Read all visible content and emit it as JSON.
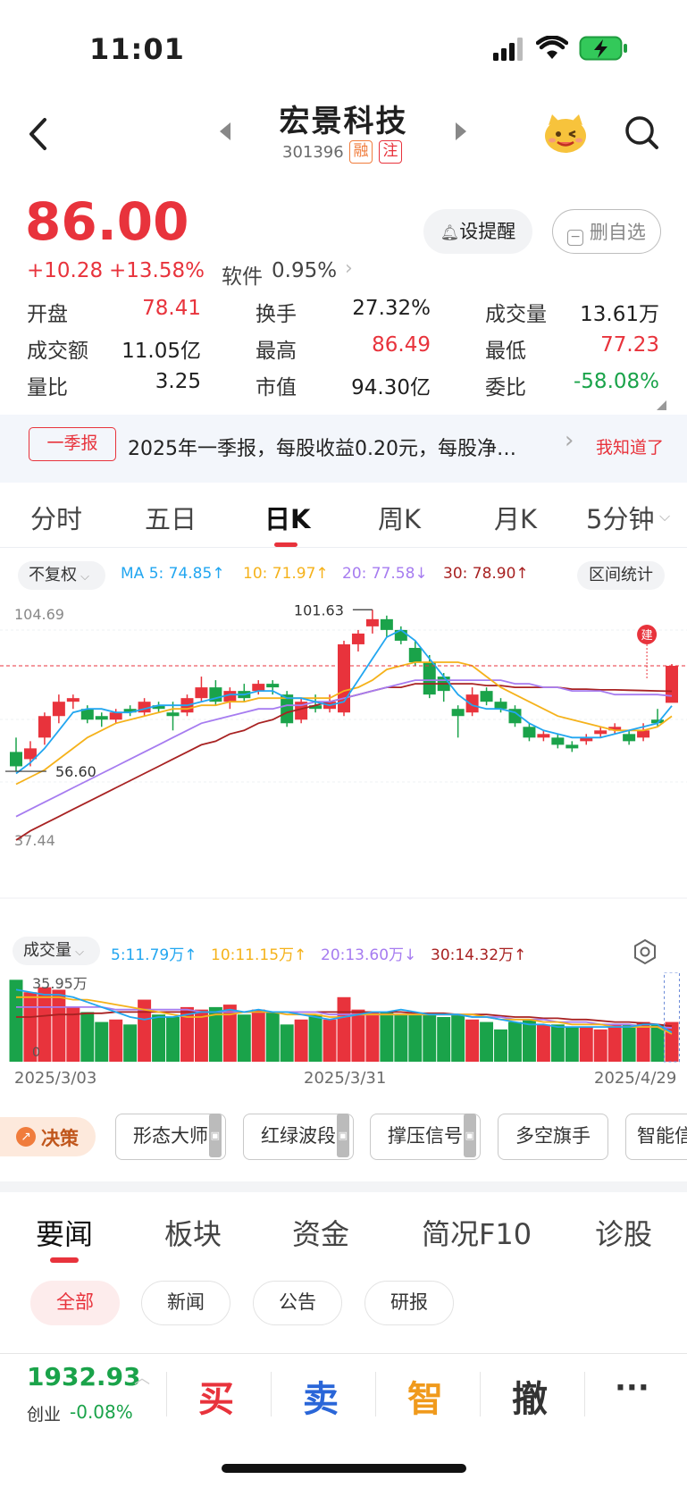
{
  "status": {
    "time": "11:01"
  },
  "header": {
    "title": "宏景科技",
    "code": "301396",
    "tag1": "融",
    "tag2": "注"
  },
  "quote": {
    "price": "86.00",
    "change": "+10.28",
    "change_pct": "+13.58%",
    "sector": "软件",
    "sector_pct": "0.95%",
    "alert_btn": "设提醒",
    "remove_btn": "删自选"
  },
  "stats": [
    {
      "label": "开盘",
      "value": "78.41",
      "color": "red"
    },
    {
      "label": "换手",
      "value": "27.32%",
      "color": "black"
    },
    {
      "label": "成交量",
      "value": "13.61万",
      "color": "black"
    },
    {
      "label": "成交额",
      "value": "11.05亿",
      "color": "black"
    },
    {
      "label": "最高",
      "value": "86.49",
      "color": "red"
    },
    {
      "label": "最低",
      "value": "77.23",
      "color": "red"
    },
    {
      "label": "量比",
      "value": "3.25",
      "color": "black"
    },
    {
      "label": "市值",
      "value": "94.30亿",
      "color": "black"
    },
    {
      "label": "委比",
      "value": "-58.08%",
      "color": "green"
    }
  ],
  "notice": {
    "badge": "一季报",
    "text": "2025年一季报，每股收益0.20元，每股净…",
    "dismiss": "我知道了"
  },
  "ktabs": [
    "分时",
    "五日",
    "日K",
    "周K",
    "月K",
    "5分钟"
  ],
  "ma": {
    "adjust": "不复权",
    "ma5": "MA 5: 74.85↑",
    "ma10": "10: 71.97↑",
    "ma20": "20: 77.58↓",
    "ma30": "30: 78.90↑",
    "range_btn": "区间统计"
  },
  "vol_ma": {
    "label": "成交量",
    "v5": "5:11.79万↑",
    "v10": "10:11.15万↑",
    "v20": "20:13.60万↓",
    "v30": "30:14.32万↑"
  },
  "chart_data": {
    "type": "candlestick",
    "price_axis": {
      "top_label": "104.69",
      "bottom_label": "37.44",
      "min": 37.44,
      "max": 104.69
    },
    "annotations": {
      "high": "101.63",
      "low": "56.60",
      "marker": "建"
    },
    "dates": [
      "2025/3/03",
      "2025/3/31",
      "2025/4/29"
    ],
    "volume_axis": {
      "top_label": "35.95万",
      "bottom_label": "0"
    },
    "candles": [
      [
        62,
        58,
        66,
        56.6
      ],
      [
        60,
        63,
        65,
        58
      ],
      [
        66,
        72,
        73,
        64
      ],
      [
        72,
        76,
        78,
        70
      ],
      [
        76,
        77,
        78,
        74
      ],
      [
        74,
        71,
        75,
        70
      ],
      [
        72,
        71,
        73,
        69
      ],
      [
        71,
        73,
        74,
        70
      ],
      [
        74,
        73,
        75,
        72
      ],
      [
        73,
        76,
        77,
        72
      ],
      [
        75,
        74,
        76,
        73
      ],
      [
        73,
        72,
        76,
        68
      ],
      [
        73,
        77,
        78,
        72
      ],
      [
        77,
        80,
        83,
        76
      ],
      [
        80,
        76,
        82,
        75
      ],
      [
        76,
        79,
        80,
        74
      ],
      [
        79,
        77,
        81,
        76
      ],
      [
        79,
        81,
        82,
        78
      ],
      [
        81,
        80,
        82,
        78
      ],
      [
        78,
        70,
        79,
        69
      ],
      [
        71,
        76,
        77,
        70
      ],
      [
        75,
        74,
        78,
        73
      ],
      [
        74,
        76,
        78,
        73
      ],
      [
        73,
        92,
        93,
        72
      ],
      [
        92,
        95,
        96,
        90
      ],
      [
        97,
        99,
        101.63,
        95
      ],
      [
        99,
        96,
        100,
        94
      ],
      [
        96,
        93,
        97,
        92
      ],
      [
        91,
        87,
        93,
        86
      ],
      [
        87,
        78,
        89,
        77
      ],
      [
        83,
        79,
        84,
        76
      ],
      [
        74,
        72,
        75,
        66
      ],
      [
        73,
        78,
        80,
        72
      ],
      [
        79,
        76,
        80,
        75
      ],
      [
        76,
        74,
        77,
        73
      ],
      [
        74,
        70,
        75,
        69
      ],
      [
        69,
        66,
        70,
        65
      ],
      [
        66,
        67,
        68,
        65
      ],
      [
        66,
        64,
        67,
        63
      ],
      [
        64,
        63,
        65,
        62
      ],
      [
        65,
        66,
        67,
        64
      ],
      [
        67,
        68,
        69,
        66
      ],
      [
        68,
        69,
        70,
        67
      ],
      [
        67,
        65,
        68,
        64
      ],
      [
        66,
        68,
        70,
        65
      ],
      [
        71,
        70,
        74,
        69
      ],
      [
        75.7,
        86.0,
        86.49,
        77.23
      ]
    ],
    "ma5": [
      56,
      59,
      63,
      68,
      73,
      74,
      74,
      73,
      73,
      74,
      75,
      75,
      75,
      76,
      77,
      78,
      78,
      79,
      79,
      77,
      77,
      76,
      75,
      76,
      82,
      88,
      94,
      96,
      93,
      88,
      83,
      78,
      75,
      74,
      74,
      73,
      70,
      68,
      67,
      66,
      66,
      66,
      67,
      68,
      69,
      70,
      74.85
    ],
    "ma10": [
      53,
      55,
      57,
      60,
      63,
      66,
      68,
      70,
      71,
      72,
      73,
      74,
      74,
      75,
      75,
      76,
      76,
      77,
      77,
      77,
      77,
      77,
      77,
      79,
      80,
      82,
      85,
      86,
      87,
      87,
      87,
      87,
      86,
      83,
      80,
      78,
      76,
      74,
      72,
      71,
      70,
      69,
      68,
      68,
      68,
      69,
      71.97
    ],
    "ma20": [
      44,
      46,
      48,
      50,
      52,
      54,
      56,
      58,
      60,
      62,
      64,
      66,
      68,
      70,
      71,
      72,
      73,
      74,
      74,
      75,
      75,
      76,
      76,
      77,
      78,
      79,
      80,
      81,
      82,
      82,
      82,
      82,
      82,
      82,
      82,
      81,
      81,
      80,
      80,
      79,
      79,
      79,
      78,
      78,
      78,
      78,
      77.58
    ],
    "ma30": [
      37.44,
      40,
      42,
      44,
      46,
      48,
      50,
      52,
      54,
      56,
      58,
      60,
      62,
      64,
      65,
      67,
      68,
      70,
      71,
      73,
      74,
      75,
      76,
      77,
      78,
      79,
      80,
      80,
      81,
      81,
      81,
      81,
      81,
      80.5,
      80.5,
      80,
      80,
      80,
      80,
      79.5,
      79.5,
      79.3,
      79.3,
      79.2,
      79.1,
      79,
      78.9
    ],
    "volumes": [
      33,
      28,
      30,
      29,
      22,
      20,
      16,
      17,
      15,
      25,
      19,
      18,
      22,
      21,
      22,
      23,
      19,
      21,
      20,
      15,
      17,
      19,
      17,
      26,
      21,
      20,
      20,
      19,
      19,
      19,
      18,
      19,
      17,
      16,
      13,
      16,
      17,
      15,
      15,
      14,
      14,
      13,
      15,
      15,
      16,
      15,
      16
    ],
    "vol_ma": {
      "v5": [
        29,
        28,
        27,
        27,
        26,
        24,
        22,
        20,
        18,
        17,
        18,
        18,
        19,
        20,
        20,
        21,
        20,
        21,
        20,
        20,
        19,
        18,
        17,
        18,
        19,
        20,
        20,
        21,
        20,
        19,
        19,
        19,
        18,
        18,
        17,
        16,
        15,
        15,
        14,
        14,
        14,
        14,
        14,
        14,
        15,
        15,
        11.79
      ],
      "v10": [
        26,
        26,
        26,
        26,
        25,
        25,
        24,
        23,
        22,
        21,
        20,
        19,
        18,
        18,
        19,
        19,
        20,
        20,
        20,
        19,
        19,
        19,
        18,
        18,
        19,
        19,
        19,
        19,
        19,
        19,
        19,
        19,
        19,
        18,
        17,
        17,
        17,
        16,
        16,
        15,
        15,
        15,
        14,
        14,
        14,
        14,
        11.15
      ],
      "v20": [
        22,
        22,
        22,
        22,
        22,
        22,
        22,
        21,
        21,
        21,
        21,
        21,
        21,
        20,
        20,
        20,
        20,
        20,
        20,
        20,
        20,
        20,
        19,
        19,
        19,
        19,
        19,
        19,
        19,
        19,
        19,
        19,
        18,
        18,
        18,
        17,
        17,
        17,
        16,
        16,
        16,
        15,
        15,
        15,
        14,
        14,
        13.6
      ],
      "v30": [
        18,
        18,
        18.5,
        19,
        19,
        19.5,
        19.5,
        20,
        20,
        20,
        20,
        20,
        20,
        20,
        20,
        20,
        20,
        20,
        20,
        20,
        20,
        20,
        20,
        20,
        20,
        20,
        20,
        20,
        19.5,
        19.5,
        19.5,
        19,
        19,
        19,
        18.5,
        18,
        18,
        17.5,
        17.5,
        17,
        17,
        16.5,
        16,
        16,
        15.5,
        15,
        14.32
      ]
    },
    "colors": {
      "up": "#e8333c",
      "down": "#1aa34a",
      "ma5": "#22a6f0",
      "ma10": "#f5b21b",
      "ma20": "#a67cf0",
      "ma30": "#a82222"
    }
  },
  "indicators": {
    "decision": "决策",
    "items": [
      "形态大师",
      "红绿波段",
      "撑压信号",
      "多空旗手",
      "智能信"
    ]
  },
  "news": {
    "tabs": [
      "要闻",
      "板块",
      "资金",
      "简况F10",
      "诊股"
    ],
    "chips": [
      "全部",
      "新闻",
      "公告",
      "研报"
    ]
  },
  "bottom": {
    "index_value": "1932.93",
    "index_name": "创业",
    "index_pct": "-0.08%",
    "buy": "买",
    "sell": "卖",
    "smart": "智",
    "cancel": "撤",
    "more": "···"
  }
}
